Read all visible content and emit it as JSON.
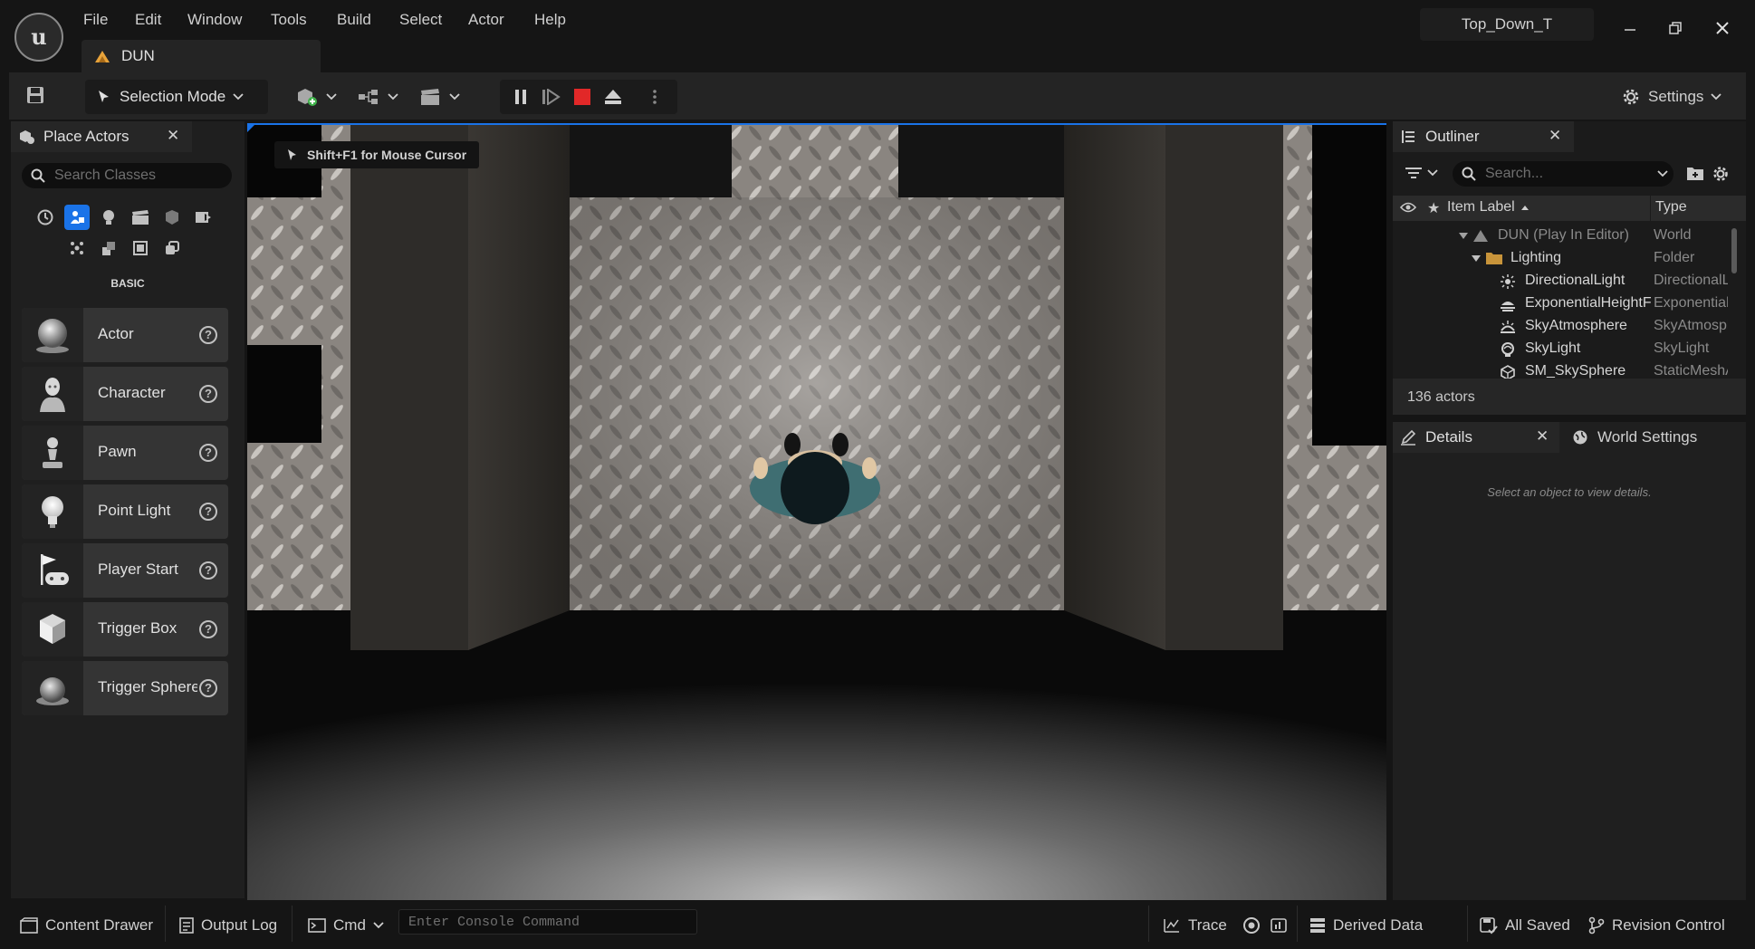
{
  "menu": [
    "File",
    "Edit",
    "Window",
    "Tools",
    "Build",
    "Select",
    "Actor",
    "Help"
  ],
  "document_tab": "DUN",
  "project_name": "Top_Down_T",
  "toolbar": {
    "selection_mode": "Selection Mode",
    "settings": "Settings"
  },
  "place_actors": {
    "tab_label": "Place Actors",
    "search_placeholder": "Search Classes",
    "category_label": "BASIC",
    "items": [
      {
        "label": "Actor",
        "icon": "sphere-icon"
      },
      {
        "label": "Character",
        "icon": "mannequin-icon"
      },
      {
        "label": "Pawn",
        "icon": "pawn-icon"
      },
      {
        "label": "Point Light",
        "icon": "lightbulb-icon"
      },
      {
        "label": "Player Start",
        "icon": "flag-gamepad-icon"
      },
      {
        "label": "Trigger Box",
        "icon": "box-icon"
      },
      {
        "label": "Trigger Sphere",
        "icon": "sphere-icon"
      }
    ]
  },
  "viewport": {
    "hint": "Shift+F1 for Mouse Cursor"
  },
  "outliner": {
    "tab_label": "Outliner",
    "search_placeholder": "Search...",
    "col_label": "Item Label",
    "col_type": "Type",
    "rows": [
      {
        "label": "DUN (Play In Editor)",
        "type": "World"
      },
      {
        "label": "Lighting",
        "type": "Folder"
      },
      {
        "label": "DirectionalLight",
        "type": "DirectionalLight"
      },
      {
        "label": "ExponentialHeightFog",
        "type": "ExponentialHeightFog"
      },
      {
        "label": "SkyAtmosphere",
        "type": "SkyAtmosphere"
      },
      {
        "label": "SkyLight",
        "type": "SkyLight"
      },
      {
        "label": "SM_SkySphere",
        "type": "StaticMeshActor"
      }
    ],
    "actor_count": "136 actors"
  },
  "details": {
    "tab_label": "Details",
    "world_settings_label": "World Settings",
    "empty_message": "Select an object to view details."
  },
  "statusbar": {
    "content_drawer": "Content Drawer",
    "output_log": "Output Log",
    "cmd": "Cmd",
    "console_placeholder": "Enter Console Command",
    "trace": "Trace",
    "derived_data": "Derived Data",
    "all_saved": "All Saved",
    "revision_control": "Revision Control"
  },
  "colors": {
    "accent_blue": "#1a73e8",
    "stop_red": "#e22828",
    "folder_orange": "#c8943a"
  }
}
